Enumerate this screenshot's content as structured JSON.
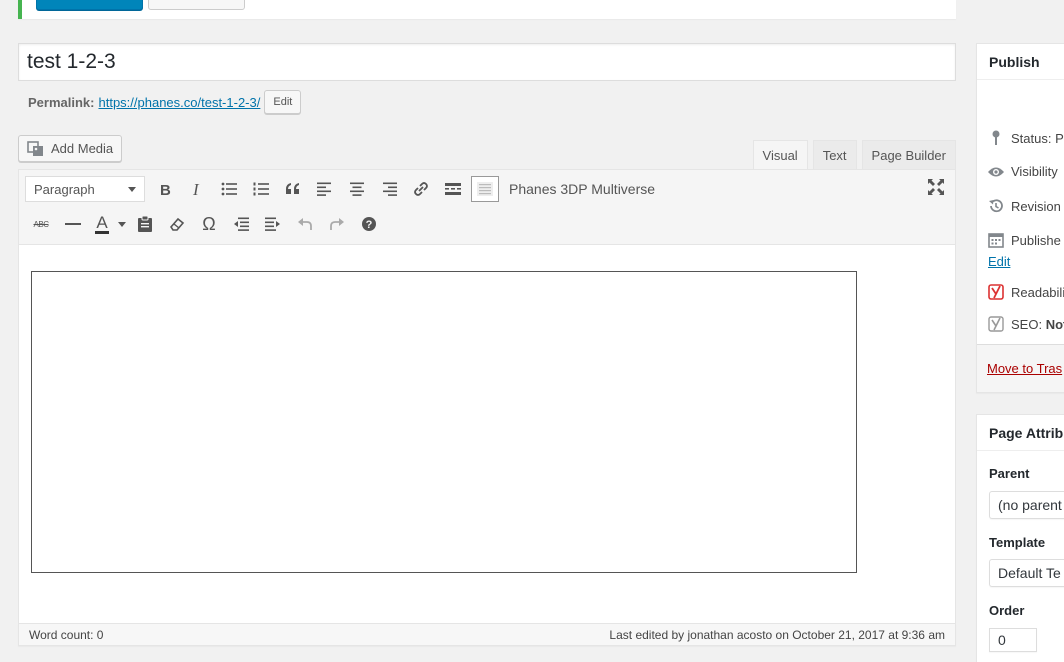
{
  "post": {
    "title": "test 1-2-3",
    "permalink_label": "Permalink:",
    "permalink_url": "https://phanes.co/test-1-2-3/",
    "edit_label": "Edit"
  },
  "media": {
    "add_media_label": "Add Media"
  },
  "editor_tabs": [
    {
      "label": "Visual",
      "active": true
    },
    {
      "label": "Text",
      "active": false
    },
    {
      "label": "Page Builder",
      "active": false
    }
  ],
  "toolbar": {
    "format_value": "Paragraph",
    "plugin_label": "Phanes 3DP Multiverse",
    "row1_icons": [
      "bold-icon",
      "italic-icon",
      "bullet-list-icon",
      "numbered-list-icon",
      "blockquote-icon",
      "align-left-icon",
      "align-center-icon",
      "align-right-icon",
      "link-icon",
      "read-more-icon",
      "toolbar-toggle-icon"
    ],
    "row2_icons": [
      "strikethrough-icon",
      "horizontal-line-icon",
      "text-color-icon",
      "paste-text-icon",
      "clear-formatting-icon",
      "special-character-icon",
      "outdent-icon",
      "indent-icon",
      "undo-icon",
      "redo-icon",
      "help-icon"
    ],
    "strike_glyph": "ABC",
    "omega_glyph": "Ω",
    "text_color_glyph": "A"
  },
  "status_bar": {
    "word_count": "Word count: 0",
    "last_edited": "Last edited by jonathan acosto on October 21, 2017 at 9:36 am"
  },
  "publish_box": {
    "title": "Publish",
    "status": "Status: P",
    "visibility": "Visibility",
    "revisions": "Revision",
    "published": "Publishe",
    "edit_link": "Edit",
    "readability": "Readabili",
    "seo_label": "SEO: ",
    "seo_value": "Not",
    "trash_link": "Move to Tras"
  },
  "attributes_box": {
    "title": "Page Attrib",
    "parent_label": "Parent",
    "parent_value": "(no parent",
    "template_label": "Template",
    "template_value": "Default Te",
    "order_label": "Order",
    "order_value": "0"
  },
  "colors": {
    "primary_button": "#0085ba",
    "link": "#0073aa",
    "trash_link": "#a00",
    "notice_border": "#46b450",
    "yoast_red": "#dc3232"
  }
}
